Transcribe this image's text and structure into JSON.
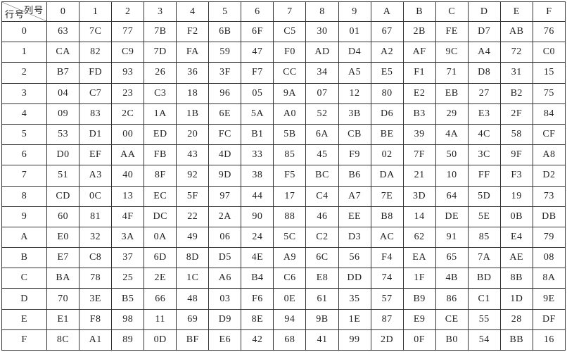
{
  "corner": {
    "row_label": "行号",
    "col_label": "列号"
  },
  "columns": [
    "0",
    "1",
    "2",
    "3",
    "4",
    "5",
    "6",
    "7",
    "8",
    "9",
    "A",
    "B",
    "C",
    "D",
    "E",
    "F"
  ],
  "row_headers": [
    "0",
    "1",
    "2",
    "3",
    "4",
    "5",
    "6",
    "7",
    "8",
    "9",
    "A",
    "B",
    "C",
    "D",
    "E",
    "F"
  ],
  "chart_data": {
    "type": "table",
    "title": "",
    "col_labels": [
      "0",
      "1",
      "2",
      "3",
      "4",
      "5",
      "6",
      "7",
      "8",
      "9",
      "A",
      "B",
      "C",
      "D",
      "E",
      "F"
    ],
    "row_labels": [
      "0",
      "1",
      "2",
      "3",
      "4",
      "5",
      "6",
      "7",
      "8",
      "9",
      "A",
      "B",
      "C",
      "D",
      "E",
      "F"
    ],
    "cells": [
      [
        "63",
        "7C",
        "77",
        "7B",
        "F2",
        "6B",
        "6F",
        "C5",
        "30",
        "01",
        "67",
        "2B",
        "FE",
        "D7",
        "AB",
        "76"
      ],
      [
        "CA",
        "82",
        "C9",
        "7D",
        "FA",
        "59",
        "47",
        "F0",
        "AD",
        "D4",
        "A2",
        "AF",
        "9C",
        "A4",
        "72",
        "C0"
      ],
      [
        "B7",
        "FD",
        "93",
        "26",
        "36",
        "3F",
        "F7",
        "CC",
        "34",
        "A5",
        "E5",
        "F1",
        "71",
        "D8",
        "31",
        "15"
      ],
      [
        "04",
        "C7",
        "23",
        "C3",
        "18",
        "96",
        "05",
        "9A",
        "07",
        "12",
        "80",
        "E2",
        "EB",
        "27",
        "B2",
        "75"
      ],
      [
        "09",
        "83",
        "2C",
        "1A",
        "1B",
        "6E",
        "5A",
        "A0",
        "52",
        "3B",
        "D6",
        "B3",
        "29",
        "E3",
        "2F",
        "84"
      ],
      [
        "53",
        "D1",
        "00",
        "ED",
        "20",
        "FC",
        "B1",
        "5B",
        "6A",
        "CB",
        "BE",
        "39",
        "4A",
        "4C",
        "58",
        "CF"
      ],
      [
        "D0",
        "EF",
        "AA",
        "FB",
        "43",
        "4D",
        "33",
        "85",
        "45",
        "F9",
        "02",
        "7F",
        "50",
        "3C",
        "9F",
        "A8"
      ],
      [
        "51",
        "A3",
        "40",
        "8F",
        "92",
        "9D",
        "38",
        "F5",
        "BC",
        "B6",
        "DA",
        "21",
        "10",
        "FF",
        "F3",
        "D2"
      ],
      [
        "CD",
        "0C",
        "13",
        "EC",
        "5F",
        "97",
        "44",
        "17",
        "C4",
        "A7",
        "7E",
        "3D",
        "64",
        "5D",
        "19",
        "73"
      ],
      [
        "60",
        "81",
        "4F",
        "DC",
        "22",
        "2A",
        "90",
        "88",
        "46",
        "EE",
        "B8",
        "14",
        "DE",
        "5E",
        "0B",
        "DB"
      ],
      [
        "E0",
        "32",
        "3A",
        "0A",
        "49",
        "06",
        "24",
        "5C",
        "C2",
        "D3",
        "AC",
        "62",
        "91",
        "85",
        "E4",
        "79"
      ],
      [
        "E7",
        "C8",
        "37",
        "6D",
        "8D",
        "D5",
        "4E",
        "A9",
        "6C",
        "56",
        "F4",
        "EA",
        "65",
        "7A",
        "AE",
        "08"
      ],
      [
        "BA",
        "78",
        "25",
        "2E",
        "1C",
        "A6",
        "B4",
        "C6",
        "E8",
        "DD",
        "74",
        "1F",
        "4B",
        "BD",
        "8B",
        "8A"
      ],
      [
        "70",
        "3E",
        "B5",
        "66",
        "48",
        "03",
        "F6",
        "0E",
        "61",
        "35",
        "57",
        "B9",
        "86",
        "C1",
        "1D",
        "9E"
      ],
      [
        "E1",
        "F8",
        "98",
        "11",
        "69",
        "D9",
        "8E",
        "94",
        "9B",
        "1E",
        "87",
        "E9",
        "CE",
        "55",
        "28",
        "DF"
      ],
      [
        "8C",
        "A1",
        "89",
        "0D",
        "BF",
        "E6",
        "42",
        "68",
        "41",
        "99",
        "2D",
        "0F",
        "B0",
        "54",
        "BB",
        "16"
      ]
    ]
  }
}
